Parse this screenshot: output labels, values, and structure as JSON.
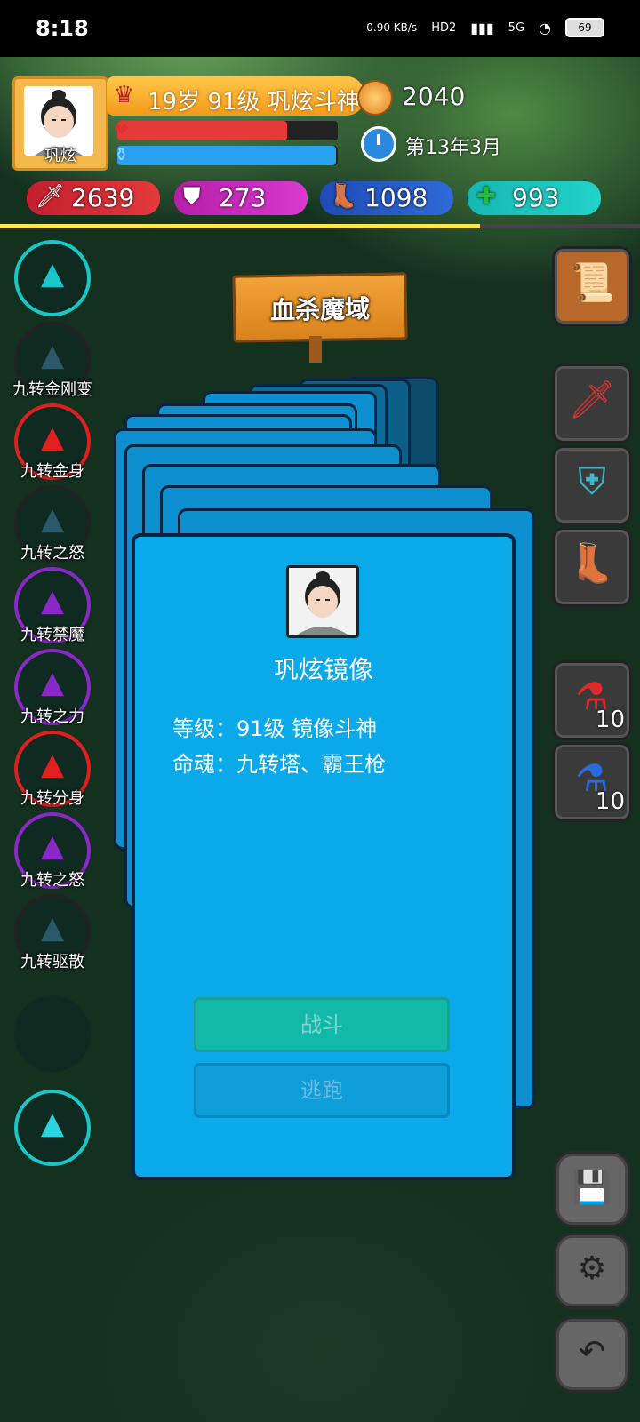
{
  "status_bar": {
    "time": "8:18",
    "net_speed": "0.90 KB/s",
    "hd": "HD2",
    "signal": "5G",
    "battery": "69"
  },
  "player": {
    "name": "巩炫",
    "level_text": "19岁 91级 巩炫斗神",
    "hp_fraction": 0.77,
    "mp_fraction": 0.99,
    "coins": "2040",
    "date": "第13年3月",
    "attack": "2639",
    "defense": "273",
    "speed": "1098",
    "health": "993",
    "progress_fraction": 0.75
  },
  "skills": [
    {
      "label": "",
      "icon": "tower-icon",
      "color": "#18c8c8"
    },
    {
      "label": "九转金刚变",
      "icon": "statue-icon",
      "color": "#222"
    },
    {
      "label": "九转金身",
      "icon": "body-icon",
      "color": "#e02020"
    },
    {
      "label": "九转之怒",
      "icon": "rage-icon",
      "color": "#222"
    },
    {
      "label": "九转禁魔",
      "icon": "seal-icon",
      "color": "#8a28c8"
    },
    {
      "label": "九转之力",
      "icon": "power-icon",
      "color": "#8a28c8"
    },
    {
      "label": "九转分身",
      "icon": "clone-icon",
      "color": "#e02020"
    },
    {
      "label": "九转之怒",
      "icon": "rage-icon",
      "color": "#8a28c8"
    },
    {
      "label": "九转驱散",
      "icon": "dispel-icon",
      "color": "#222"
    }
  ],
  "location": "血杀魔域",
  "enemy_card": {
    "name": "巩炫镜像",
    "level_line": "等级：91级 镜像斗神",
    "soul_line": "命魂：九转塔、霸王枪",
    "fight_label": "战斗",
    "flee_label": "逃跑"
  },
  "inventory": {
    "hp_potion_count": "10",
    "mp_potion_count": "10"
  }
}
